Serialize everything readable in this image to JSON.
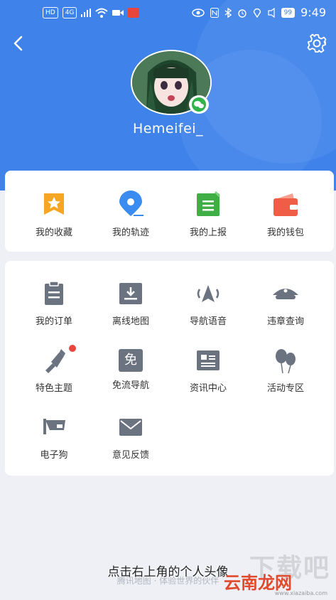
{
  "status_bar": {
    "left_chip": "HD",
    "net_chip": "4G",
    "battery": "99",
    "time": "9:49"
  },
  "profile": {
    "username": "Hemeifei_"
  },
  "quick_actions": [
    {
      "label": "我的收藏",
      "icon": "star-bookmark-icon",
      "color": "#f6a623"
    },
    {
      "label": "我的轨迹",
      "icon": "location-pin-icon",
      "color": "#3b8cf0"
    },
    {
      "label": "我的上报",
      "icon": "report-note-icon",
      "color": "#3fae44"
    },
    {
      "label": "我的钱包",
      "icon": "wallet-icon",
      "color": "#f05d47"
    }
  ],
  "services": [
    {
      "label": "我的订单",
      "icon": "order-clipboard-icon"
    },
    {
      "label": "离线地图",
      "icon": "download-tray-icon"
    },
    {
      "label": "导航语音",
      "icon": "navigation-voice-icon"
    },
    {
      "label": "违章查询",
      "icon": "police-cap-icon"
    },
    {
      "label": "特色主题",
      "icon": "paint-brush-icon",
      "badge": true
    },
    {
      "label": "免流导航",
      "icon": "free-data-icon",
      "glyph": "免"
    },
    {
      "label": "资讯中心",
      "icon": "news-icon"
    },
    {
      "label": "活动专区",
      "icon": "balloons-icon"
    },
    {
      "label": "电子狗",
      "icon": "speed-camera-icon"
    },
    {
      "label": "意见反馈",
      "icon": "envelope-icon"
    }
  ],
  "subtitle": "点击右上角的个人头像",
  "footer": "腾讯地图 · 体验世界的伙伴",
  "watermark": {
    "big": "下载吧",
    "brand": "云南龙网",
    "url": "www.xiazaiba.com"
  },
  "colors": {
    "header_blue": "#3f83ea",
    "icon_gray": "#6b7280"
  }
}
